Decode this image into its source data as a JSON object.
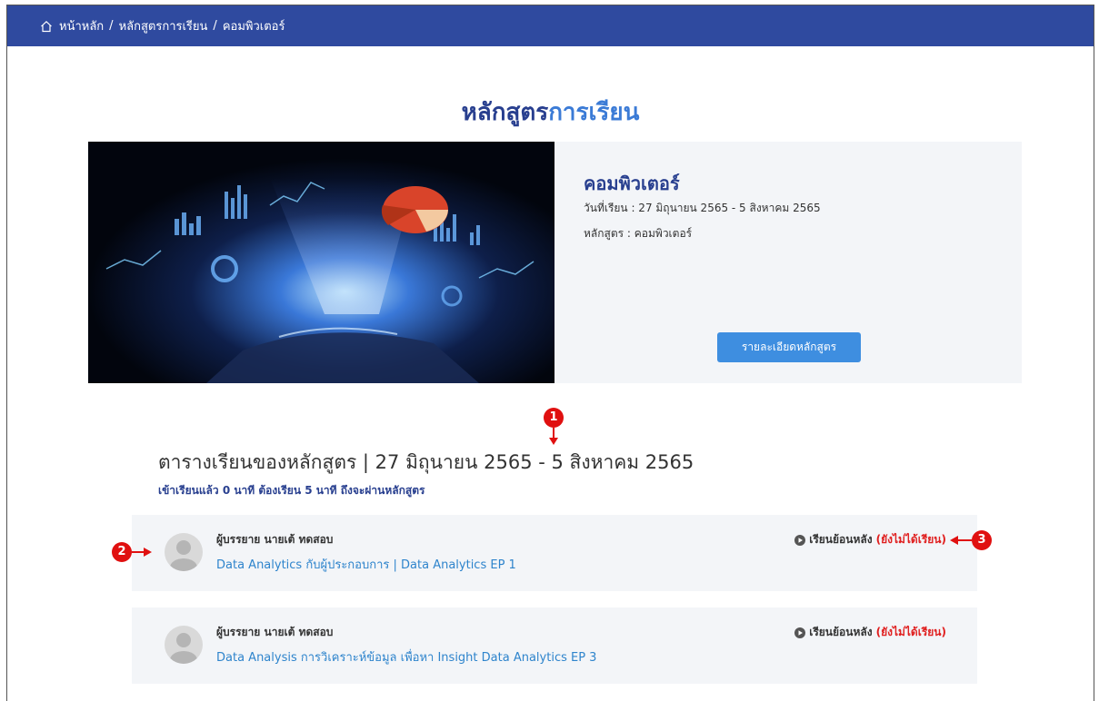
{
  "breadcrumb": {
    "home": "หน้าหลัก",
    "courses": "หลักสูตรการเรียน",
    "current": "คอมพิวเตอร์",
    "separator": "/"
  },
  "page_title": {
    "part1": "หลักสูตร",
    "part2": "การเรียน"
  },
  "course": {
    "name": "คอมพิวเตอร์",
    "date_line": "วันที่เรียน : 27 มิถุนายน 2565 - 5 สิงหาคม 2565",
    "course_line": "หลักสูตร : คอมพิวเตอร์",
    "detail_button": "รายละเอียดหลักสูตร"
  },
  "schedule": {
    "title": "ตารางเรียนของหลักสูตร | 27 มิถุนายน 2565 - 5 สิงหาคม 2565",
    "progress_note": "เข้าเรียนแล้ว 0 นาที ต้องเรียน 5 นาที ถึงจะผ่านหลักสูตร"
  },
  "lessons": [
    {
      "lecturer": "ผู้บรรยาย นายเต้ ทดสอบ",
      "title": "Data Analytics กับผู้ประกอบการ | Data Analytics EP 1",
      "replay_label": "เรียนย้อนหลัง",
      "status": "(ยังไม่ได้เรียน)"
    },
    {
      "lecturer": "ผู้บรรยาย นายเต้ ทดสอบ",
      "title": "Data Analysis การวิเคราะห์ข้อมูล เพื่อหา Insight Data Analytics EP 3",
      "replay_label": "เรียนย้อนหลัง",
      "status": "(ยังไม่ได้เรียน)"
    }
  ],
  "callouts": [
    "1",
    "2",
    "3"
  ],
  "colors": {
    "topbar": "#2f4a9f",
    "title_dark": "#283f8f",
    "title_accent": "#3b7bd6",
    "button": "#3e8ee0",
    "link": "#2e84cc",
    "status": "#e02020",
    "callout": "#e01010"
  }
}
